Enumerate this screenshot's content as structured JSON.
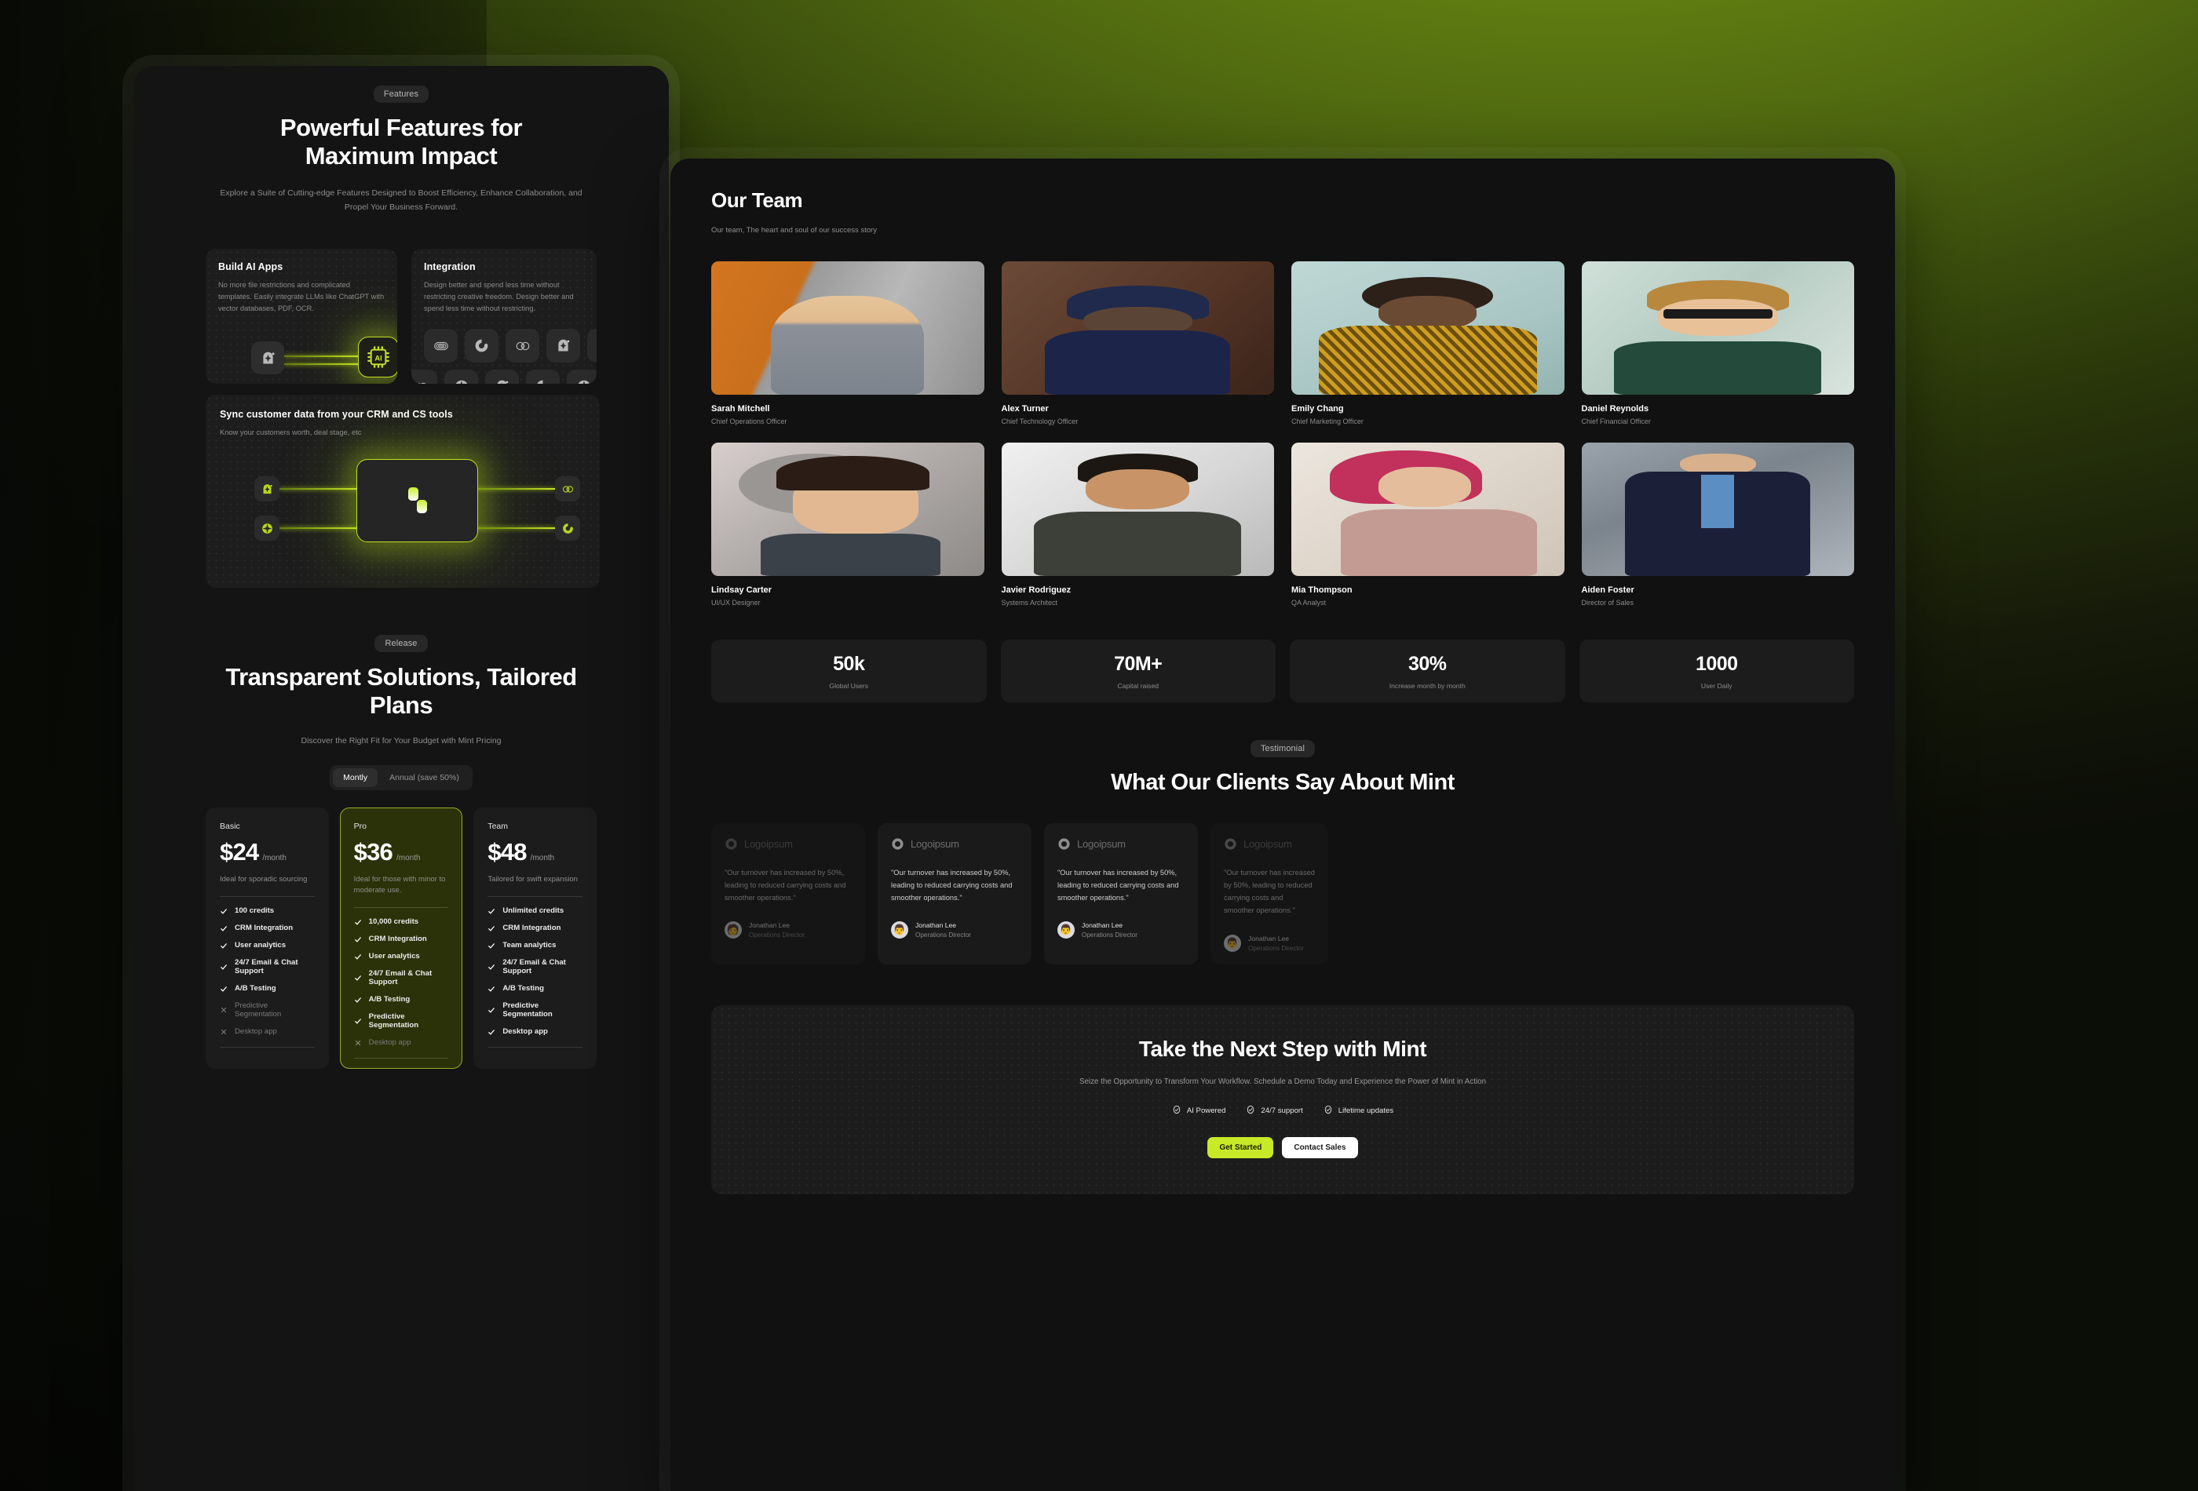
{
  "left_panel": {
    "badge": "Features",
    "title": "Powerful Features for Maximum Impact",
    "subtitle": "Explore a Suite of Cutting-edge Features Designed to Boost Efficiency, Enhance Collaboration, and Propel Your Business Forward.",
    "cards": [
      {
        "title": "Build AI Apps",
        "desc": "No more file restrictions and complicated templates. Easily integrate LLMs like ChatGPT with vector databases, PDF, OCR.",
        "chip_label": "AI"
      },
      {
        "title": "Integration",
        "desc": "Design better and spend less time without restricting creative freedom. Design better and spend less time without restricting."
      }
    ],
    "wide_card": {
      "title": "Sync customer data from your CRM and CS tools",
      "desc": "Know your customers worth, deal stage, etc"
    },
    "integration_icons_row1": [
      "loop-icon",
      "drop-icon",
      "spiral-icon",
      "arch-icon",
      "loop-icon"
    ],
    "integration_icons_row2": [
      "spiral-icon",
      "diamond-icon",
      "arch-icon",
      "drop-icon",
      "diamond-icon",
      "arch-icon"
    ],
    "crm_nodes_left": [
      "arch-icon",
      "diamond-icon"
    ],
    "crm_nodes_right": [
      "spiral-icon",
      "drop-icon"
    ]
  },
  "pricing": {
    "badge": "Release",
    "title": "Transparent Solutions, Tailored Plans",
    "subtitle": "Discover the Right Fit for Your Budget with Mint Pricing",
    "toggle": {
      "monthly": "Montly",
      "annual": "Annual (save 50%)",
      "active": "Montly"
    },
    "plans": [
      {
        "name": "Basic",
        "price": "$24",
        "period": "/month",
        "tagline": "Ideal for sporadic sourcing",
        "features": [
          {
            "label": "100 credits",
            "included": true
          },
          {
            "label": "CRM Integration",
            "included": true
          },
          {
            "label": "User analytics",
            "included": true
          },
          {
            "label": "24/7 Email & Chat Support",
            "included": true
          },
          {
            "label": "A/B Testing",
            "included": true
          },
          {
            "label": "Predictive Segmentation",
            "included": false
          },
          {
            "label": "Desktop app",
            "included": false
          }
        ]
      },
      {
        "name": "Pro",
        "price": "$36",
        "period": "/month",
        "tagline": "Ideal for those with minor to moderate use.",
        "featured": true,
        "features": [
          {
            "label": "10,000 credits",
            "included": true
          },
          {
            "label": "CRM Integration",
            "included": true
          },
          {
            "label": "User analytics",
            "included": true
          },
          {
            "label": "24/7 Email & Chat Support",
            "included": true
          },
          {
            "label": "A/B Testing",
            "included": true
          },
          {
            "label": "Predictive Segmentation",
            "included": true
          },
          {
            "label": "Desktop app",
            "included": false
          }
        ]
      },
      {
        "name": "Team",
        "price": "$48",
        "period": "/month",
        "tagline": "Tailored for swift expansion",
        "features": [
          {
            "label": "Unlimited credits",
            "included": true
          },
          {
            "label": "CRM Integration",
            "included": true
          },
          {
            "label": "Team analytics",
            "included": true
          },
          {
            "label": "24/7 Email & Chat Support",
            "included": true
          },
          {
            "label": "A/B Testing",
            "included": true
          },
          {
            "label": "Predictive Segmentation",
            "included": true
          },
          {
            "label": "Desktop app",
            "included": true
          }
        ]
      }
    ]
  },
  "team": {
    "title": "Our Team",
    "subtitle": "Our team, The heart and soul of our success story",
    "members": [
      {
        "name": "Sarah Mitchell",
        "role": "Chief Operations Officer",
        "photo": "woman-blonde-suit-city"
      },
      {
        "name": "Alex Turner",
        "role": "Chief Technology Officer",
        "photo": "man-beret-navy-turtleneck"
      },
      {
        "name": "Emily Chang",
        "role": "Chief Marketing Officer",
        "photo": "woman-yellow-scarf"
      },
      {
        "name": "Daniel Reynolds",
        "role": "Chief Financial Officer",
        "photo": "man-glasses-green-shirt"
      },
      {
        "name": "Lindsay Carter",
        "role": "UI/UX Designer",
        "photo": "woman-dark-hair-profile"
      },
      {
        "name": "Javier Rodriguez",
        "role": "Systems Architect",
        "photo": "man-dark-shirt-studio"
      },
      {
        "name": "Mia Thompson",
        "role": "QA Analyst",
        "photo": "woman-pink-hair"
      },
      {
        "name": "Aiden Foster",
        "role": "Director of Sales",
        "photo": "man-navy-suit-tunnel"
      }
    ]
  },
  "stats": [
    {
      "value": "50k",
      "label": "Global Users"
    },
    {
      "value": "70M+",
      "label": "Capital raised"
    },
    {
      "value": "30%",
      "label": "Increase month by month"
    },
    {
      "value": "1000",
      "label": "User Daily"
    }
  ],
  "testimonials": {
    "badge": "Testimonial",
    "title": "What Our Clients Say About Mint",
    "items": [
      {
        "logo": "Logoipsum",
        "quote": "\"Our turnover has increased by 50%, leading to reduced carrying costs and smoother operations.\"",
        "name": "Jonathan Lee",
        "role": "Operations Director"
      },
      {
        "logo": "Logoipsum",
        "quote": "\"Our turnover has increased by 50%, leading to reduced carrying costs and smoother operations.\"",
        "name": "Jonathan Lee",
        "role": "Operations Director"
      },
      {
        "logo": "Logoipsum",
        "quote": "\"Our turnover has increased by 50%, leading to reduced carrying costs and smoother operations.\"",
        "name": "Jonathan Lee",
        "role": "Operations Director"
      },
      {
        "logo": "Logoipsum",
        "quote": "\"Our turnover has increased by 50%, leading to reduced carrying costs and smoother operations.\"",
        "name": "Jonathan Lee",
        "role": "Operations Director"
      }
    ]
  },
  "cta": {
    "title": "Take the Next Step with Mint",
    "subtitle": "Seize the Opportunity to Transform Your Workflow. Schedule a Demo Today and Experience the Power of Mint in Action",
    "features": [
      "AI Powered",
      "24/7 support",
      "Lifetime updates"
    ],
    "primary_button": "Get Started",
    "secondary_button": "Contact Sales"
  },
  "colors": {
    "accent": "#c8e927",
    "accent_dim": "#97ad23",
    "panel": "#141414",
    "panel_right": "#111111",
    "card": "#1c1c1c",
    "featured_plan_bg": "#2b3209",
    "background_green": "#7d9d16"
  }
}
